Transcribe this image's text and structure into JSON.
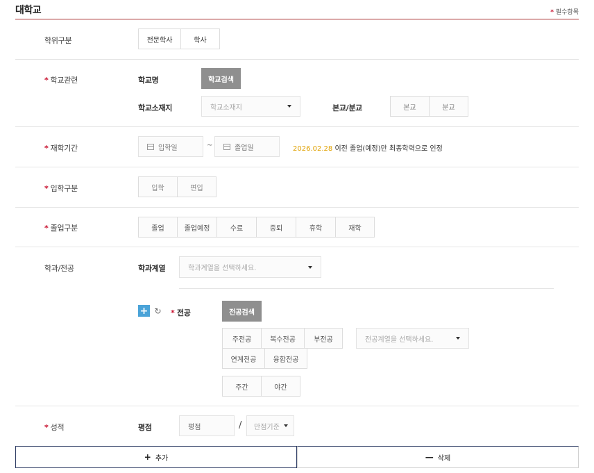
{
  "header": {
    "title": "대학교",
    "required_star": "*",
    "required_note": "필수항목"
  },
  "degree": {
    "label": "학위구분",
    "options": [
      "전문학사",
      "학사"
    ]
  },
  "school": {
    "label": "학교관련",
    "name_label": "학교명",
    "search_button": "학교검색",
    "location_label": "학교소재지",
    "location_placeholder": "학교소재지",
    "campus_label": "본교/분교",
    "campus_options": [
      "본교",
      "분교"
    ]
  },
  "period": {
    "label": "재학기간",
    "start_placeholder": "입학일",
    "tilde": "~",
    "end_placeholder": "졸업일",
    "notice_date": "2026.02.28",
    "notice_text": " 이전 졸업(예정)만 최종학력으로 인정"
  },
  "admission": {
    "label": "입학구분",
    "options": [
      "입학",
      "편입"
    ]
  },
  "graduation": {
    "label": "졸업구분",
    "options": [
      "졸업",
      "졸업예정",
      "수료",
      "중퇴",
      "휴학",
      "재학"
    ]
  },
  "major": {
    "label": "학과/전공",
    "category_label": "학과계열",
    "category_placeholder": "학과계열을 선택하세요.",
    "plus": "+",
    "refresh": "↻",
    "major_label": "전공",
    "search_button": "전공검색",
    "type_options_row1": [
      "주전공",
      "복수전공",
      "부전공"
    ],
    "type_options_row2": [
      "연계전공",
      "융합전공"
    ],
    "major_category_placeholder": "전공계열을 선택하세요.",
    "time_options": [
      "주간",
      "야간"
    ]
  },
  "grade": {
    "label": "성적",
    "gpa_label": "평점",
    "gpa_placeholder": "평점",
    "slash": "/",
    "scale_placeholder": "만점기준"
  },
  "actions": {
    "add_icon": "+",
    "add_label": "추가",
    "delete_icon": "—",
    "delete_label": "삭제"
  }
}
